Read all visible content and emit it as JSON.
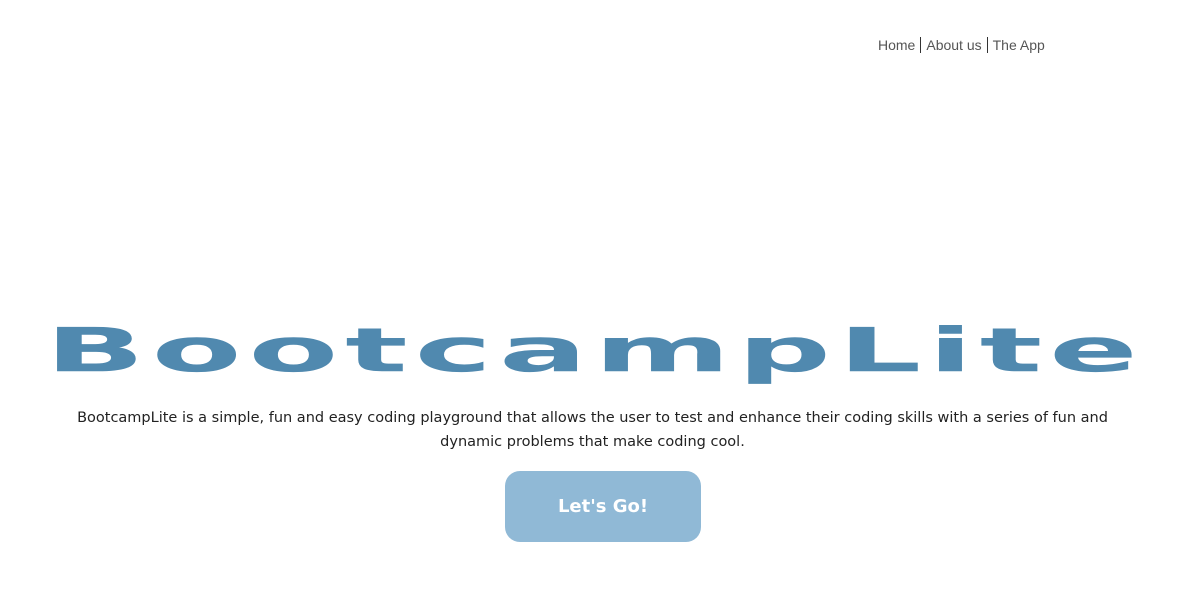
{
  "nav": {
    "items": [
      {
        "label": "Home"
      },
      {
        "label": "About us"
      },
      {
        "label": "The App"
      }
    ]
  },
  "hero": {
    "title": "BootcampLite",
    "description": "BootcampLite is a simple, fun and easy coding playground that allows the user to test and enhance their coding skills with a series of fun and dynamic problems that make coding cool.",
    "cta_label": "Let's Go!"
  },
  "colors": {
    "title": "#5089af",
    "button": "#90b9d6",
    "background": "#ffffff"
  }
}
